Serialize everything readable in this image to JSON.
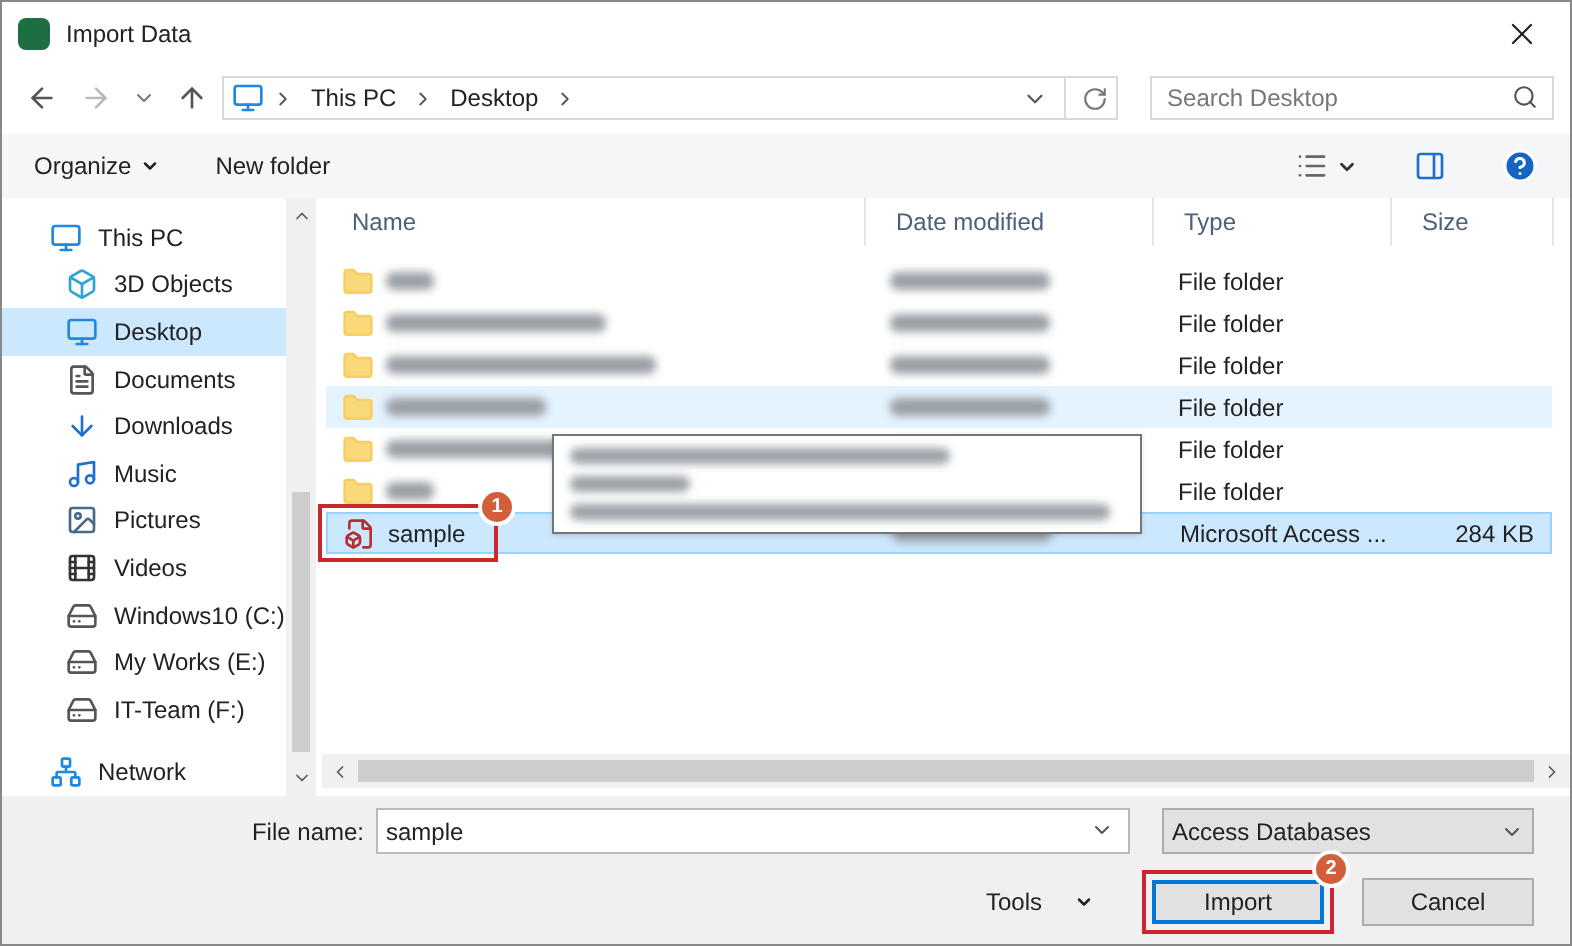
{
  "window": {
    "title": "Import Data"
  },
  "address_bar": {
    "path": [
      "This PC",
      "Desktop"
    ]
  },
  "search": {
    "placeholder": "Search Desktop"
  },
  "toolbar": {
    "organize": "Organize",
    "new_folder": "New folder"
  },
  "sidebar": {
    "items": [
      {
        "label": "This PC",
        "selected": false,
        "children": [
          {
            "label": "3D Objects",
            "selected": false
          },
          {
            "label": "Desktop",
            "selected": true
          },
          {
            "label": "Documents",
            "selected": false
          },
          {
            "label": "Downloads",
            "selected": false
          },
          {
            "label": "Music",
            "selected": false
          },
          {
            "label": "Pictures",
            "selected": false
          },
          {
            "label": "Videos",
            "selected": false
          },
          {
            "label": "Windows10 (C:)",
            "selected": false
          },
          {
            "label": "My Works (E:)",
            "selected": false
          },
          {
            "label": "IT-Team (F:)",
            "selected": false
          }
        ]
      },
      {
        "label": "Network",
        "selected": false
      }
    ]
  },
  "table": {
    "columns": [
      "Name",
      "Date modified",
      "Type",
      "Size"
    ],
    "rows": [
      {
        "kind": "folder",
        "type": "File folder",
        "selected": false,
        "hovered": false
      },
      {
        "kind": "folder",
        "type": "File folder",
        "selected": false,
        "hovered": false
      },
      {
        "kind": "folder",
        "type": "File folder",
        "selected": false,
        "hovered": false
      },
      {
        "kind": "folder",
        "type": "File folder",
        "selected": false,
        "hovered": true
      },
      {
        "kind": "folder",
        "type": "File folder",
        "selected": false,
        "hovered": false
      },
      {
        "kind": "folder",
        "type": "File folder",
        "selected": false,
        "hovered": false
      },
      {
        "kind": "file",
        "name": "sample",
        "type": "Microsoft Access ...",
        "size": "284 KB",
        "selected": true,
        "hovered": false,
        "callout": "1"
      }
    ]
  },
  "file_name": {
    "label": "File name:",
    "value": "sample"
  },
  "file_type": {
    "value": "Access Databases"
  },
  "buttons": {
    "tools": "Tools",
    "import": "Import",
    "import_callout": "2",
    "cancel": "Cancel"
  }
}
